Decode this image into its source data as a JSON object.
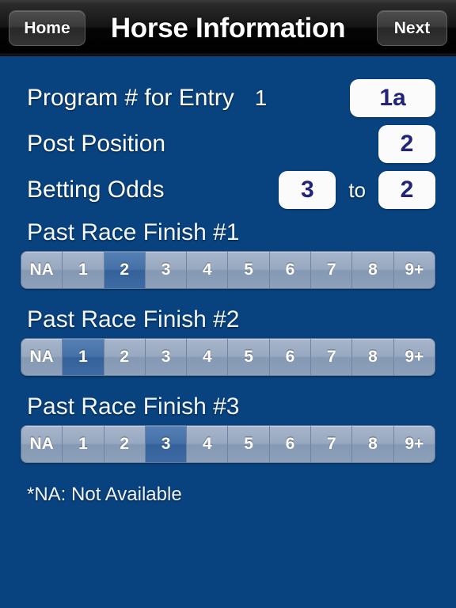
{
  "navbar": {
    "home_label": "Home",
    "title": "Horse Information",
    "next_label": "Next"
  },
  "form": {
    "program_label": "Program # for Entry",
    "program_entry_number": "1",
    "program_value": "1a",
    "post_position_label": "Post Position",
    "post_position_value": "2",
    "betting_odds_label": "Betting Odds",
    "betting_odds_numerator": "3",
    "betting_odds_to": "to",
    "betting_odds_denominator": "2"
  },
  "segment_options": [
    "NA",
    "1",
    "2",
    "3",
    "4",
    "5",
    "6",
    "7",
    "8",
    "9+"
  ],
  "sections": [
    {
      "heading": "Past Race Finish #1",
      "selected": "2"
    },
    {
      "heading": "Past Race Finish #2",
      "selected": "1"
    },
    {
      "heading": "Past Race Finish #3",
      "selected": "3"
    }
  ],
  "footnote": "*NA: Not Available",
  "colors": {
    "background": "#08437f",
    "navbar": "#000000",
    "field_text": "#23237a",
    "segment_selected": "#3f6ba4",
    "segment_unselected": "#97a8c0"
  }
}
